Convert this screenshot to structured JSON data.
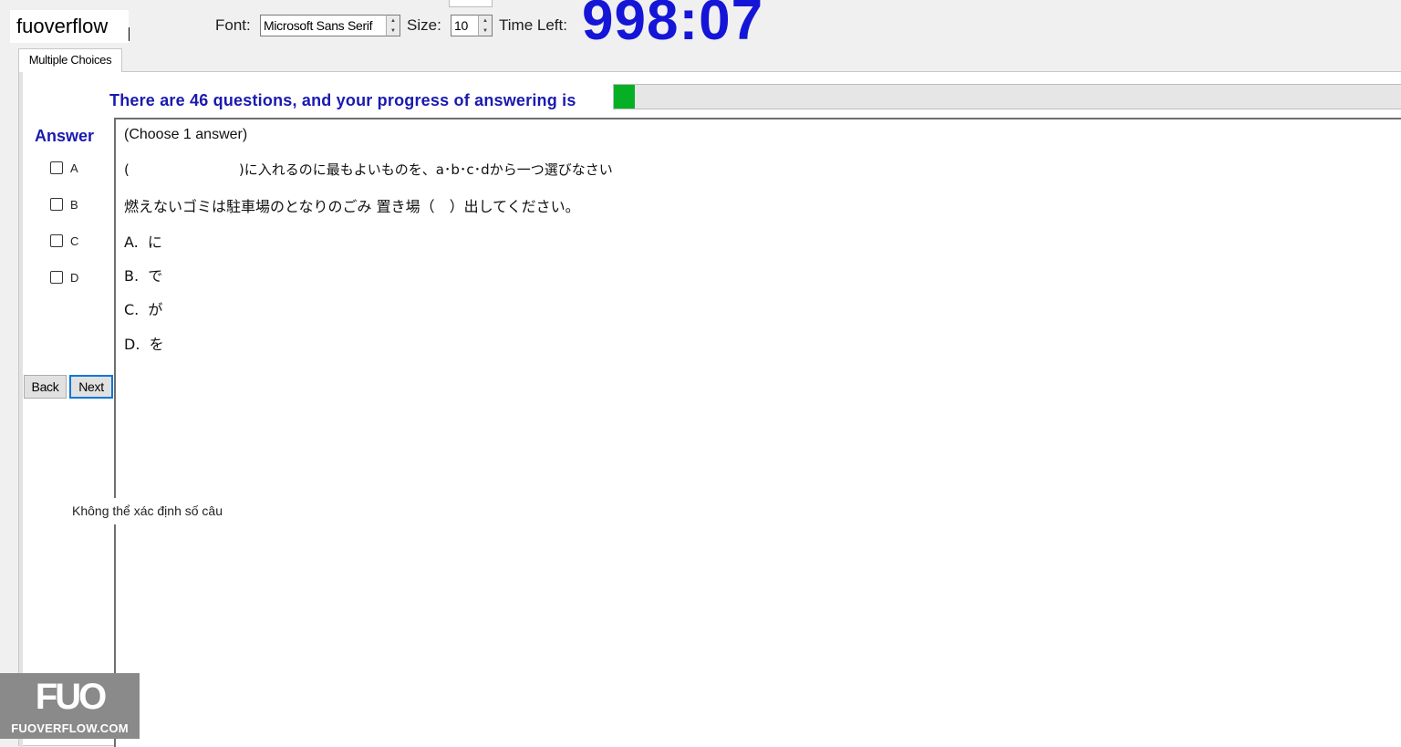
{
  "app": {
    "logo_text": "fuoverflow"
  },
  "toolbar": {
    "font_label": "Font:",
    "font_value": "Microsoft Sans Serif",
    "size_label": "Size:",
    "size_value": "10",
    "time_label": "Time Left:",
    "time_value": "998:07"
  },
  "tabs": [
    {
      "label": "Multiple Choices"
    }
  ],
  "progress": {
    "text": "There are 46 questions, and your progress of answering is",
    "fraction": 0.026,
    "color": "#06b025"
  },
  "answer": {
    "title": "Answer",
    "options": [
      {
        "label": "A"
      },
      {
        "label": "B"
      },
      {
        "label": "C"
      },
      {
        "label": "D"
      }
    ]
  },
  "buttons": {
    "back": "Back",
    "next": "Next"
  },
  "question": {
    "instruction": "(Choose 1 answer)",
    "prompt": "(　　　　　　　　)に入れるのに最もよいものを、a･b･c･dから一つ選びなさい",
    "sentence": "燃えないゴミは駐車場のとなりのごみ 置き場（　）出してください。",
    "choices": [
      "A.  に",
      "B.  で",
      "C.  が",
      "D.  を"
    ]
  },
  "status_text": "Không thể xác định số câu",
  "watermark": {
    "big": "FUO",
    "small": "FUOVERFLOW.COM"
  }
}
